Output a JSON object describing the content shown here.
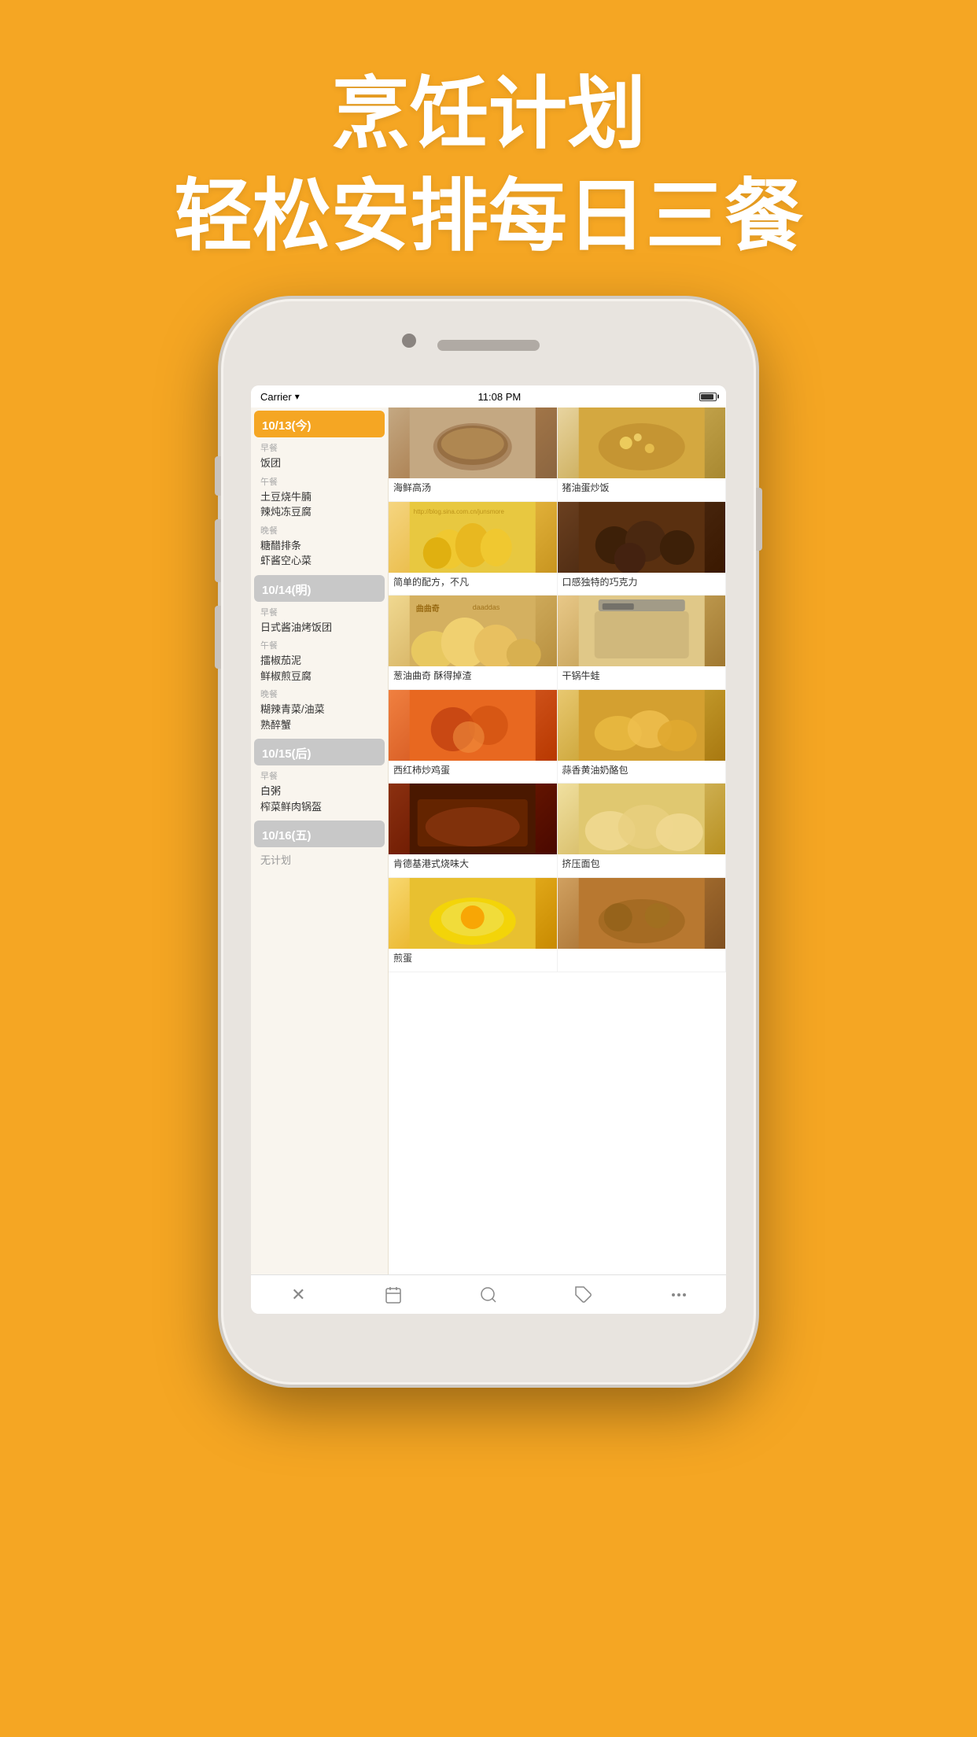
{
  "hero": {
    "line1": "烹饪计划",
    "line2": "轻松安排每日三餐"
  },
  "status_bar": {
    "carrier": "Carrier",
    "time": "11:08 PM",
    "wifi": "WiFi"
  },
  "dates": [
    {
      "id": "today",
      "label": "10/13(今)",
      "style": "today",
      "meals": [
        {
          "type": "早餐",
          "items": [
            "饭团"
          ]
        },
        {
          "type": "午餐",
          "items": [
            "土豆烧牛腩",
            "辣炖冻豆腐"
          ]
        },
        {
          "type": "晚餐",
          "items": [
            "糖醋排条",
            "虾酱空心菜"
          ]
        }
      ]
    },
    {
      "id": "tomorrow",
      "label": "10/14(明)",
      "style": "other",
      "meals": [
        {
          "type": "早餐",
          "items": [
            "日式酱油烤饭团"
          ]
        },
        {
          "type": "午餐",
          "items": [
            "擂椒茄泥",
            "鲜椒煎豆腐"
          ]
        },
        {
          "type": "晚餐",
          "items": [
            "糊辣青菜/油菜",
            "熟醉蟹"
          ]
        }
      ]
    },
    {
      "id": "day_after",
      "label": "10/15(后)",
      "style": "other",
      "meals": [
        {
          "type": "早餐",
          "items": [
            "白粥",
            "榨菜鲜肉锅盔"
          ]
        }
      ]
    },
    {
      "id": "friday",
      "label": "10/16(五)",
      "style": "other",
      "meals": [],
      "no_plan": "无计划"
    }
  ],
  "recipes": [
    {
      "id": "r1",
      "title": "海鲜高汤",
      "img_class": "img-seafood-soup",
      "color1": "#c4a882",
      "color2": "#8b6540"
    },
    {
      "id": "r2",
      "title": "猪油蛋炒饭",
      "img_class": "img-fried-rice",
      "color1": "#e8c870",
      "color2": "#a88030"
    },
    {
      "id": "r3",
      "title": "简单的配方，不凡",
      "img_class": "img-cookies-yellow",
      "color1": "#f5d580",
      "color2": "#c89520"
    },
    {
      "id": "r4",
      "title": "口感独特的巧克力",
      "img_class": "img-cookies-brown",
      "color1": "#6b4020",
      "color2": "#3a1800"
    },
    {
      "id": "r5",
      "title": "葱油曲奇 酥得掉渣",
      "img_class": "img-scallion-cookies",
      "color1": "#f0d890",
      "color2": "#b89040",
      "overlay": "曲曲奇"
    },
    {
      "id": "r6",
      "title": "干锅牛蛙",
      "img_class": "img-dry-pot-frog",
      "color1": "#e8c888",
      "color2": "#a07830"
    },
    {
      "id": "r7",
      "title": "西红柿炒鸡蛋",
      "img_class": "img-tomato-eggs",
      "color1": "#f08040",
      "color2": "#b83800"
    },
    {
      "id": "r8",
      "title": "蒜香黄油奶酪包",
      "img_class": "img-butter-bread",
      "color1": "#e8c870",
      "color2": "#a87810"
    },
    {
      "id": "r9",
      "title": "肯德基港式烧味大",
      "img_class": "img-kfc-roast",
      "color1": "#8b3010",
      "color2": "#4a0800"
    },
    {
      "id": "r10",
      "title": "挤压面包",
      "img_class": "img-squeeze-bread",
      "color1": "#f0e0a0",
      "color2": "#b89020"
    },
    {
      "id": "r11",
      "title": "煎蛋",
      "img_class": "img-fried-egg",
      "color1": "#f8d870",
      "color2": "#c88a00"
    },
    {
      "id": "r12",
      "title": "",
      "img_class": "img-food-last",
      "color1": "#d0a060",
      "color2": "#805020"
    }
  ],
  "toolbar": {
    "close": "✕",
    "calendar": "📅",
    "search": "🔍",
    "tag": "🏷",
    "more": "⋯"
  }
}
